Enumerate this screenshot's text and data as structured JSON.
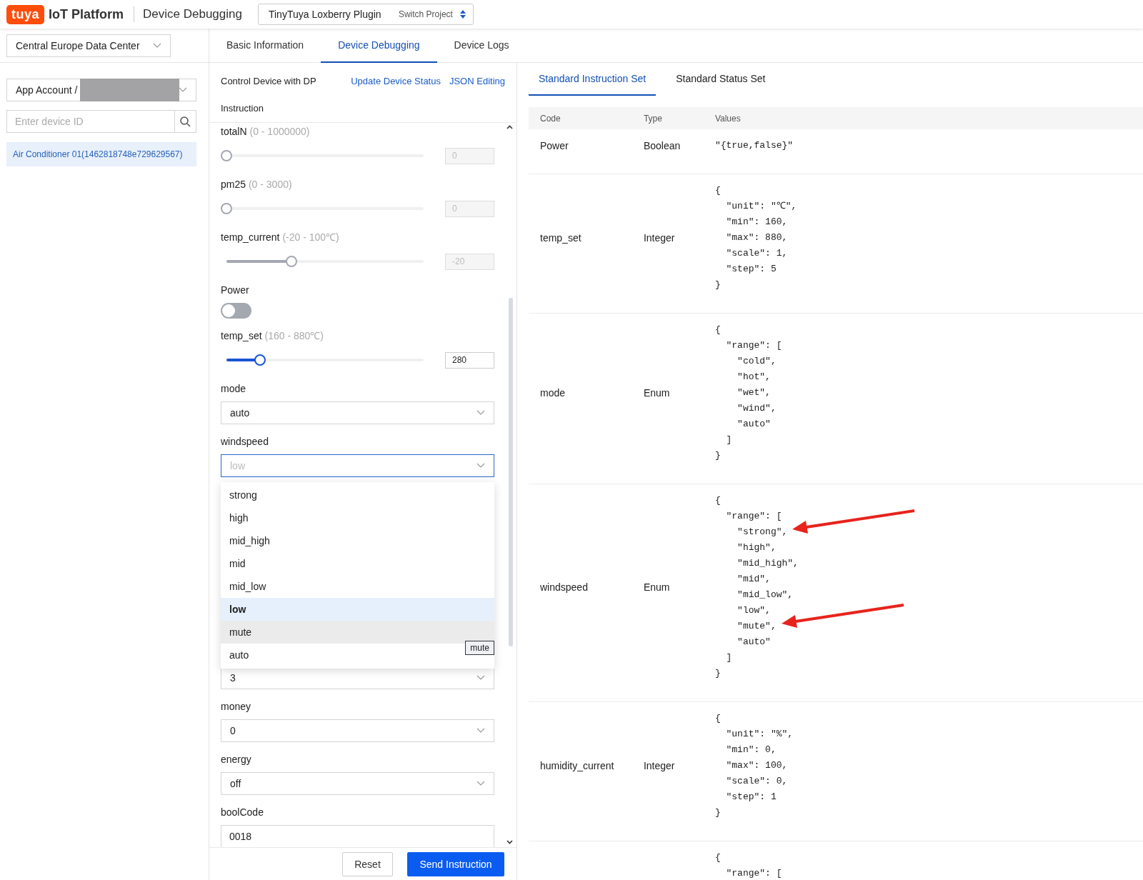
{
  "header": {
    "logo": "tuya",
    "platform": "IoT Platform",
    "page_title": "Device Debugging",
    "project": {
      "name": "TinyTuya Loxberry Plugin",
      "action": "Switch Project"
    }
  },
  "sidebar": {
    "data_center": "Central Europe Data Center",
    "account": {
      "label": "App Account /",
      "redacted": true
    },
    "search": {
      "placeholder": "Enter device ID"
    },
    "devices": [
      {
        "name": "Air Conditioner 01(1462818748e729629567)",
        "selected": true
      }
    ]
  },
  "tabs": [
    {
      "label": "Basic Information",
      "selected": false
    },
    {
      "label": "Device Debugging",
      "selected": true
    },
    {
      "label": "Device Logs",
      "selected": false
    }
  ],
  "control": {
    "title": "Control Device with DP",
    "links": [
      "Update Device Status",
      "JSON Editing"
    ],
    "section": "Instruction",
    "fields": [
      {
        "kind": "slider",
        "label": "totalN",
        "range": "(0 - 1000000)",
        "level": 0,
        "value": "0",
        "disabled": true
      },
      {
        "kind": "slider",
        "label": "pm25",
        "range": "(0 - 3000)",
        "level": 0,
        "value": "0",
        "disabled": true
      },
      {
        "kind": "slider",
        "label": "temp_current",
        "range": "(-20 - 100℃)",
        "level": 0.33,
        "value": "-20",
        "disabled": true
      },
      {
        "kind": "switch",
        "label": "Power",
        "on": false
      },
      {
        "kind": "slider",
        "label": "temp_set",
        "range": "(160 - 880℃)",
        "level": 0.17,
        "value": "280",
        "disabled": false
      },
      {
        "kind": "select",
        "label": "mode",
        "value": "auto",
        "open": false
      },
      {
        "kind": "select",
        "label": "windspeed",
        "value": "low",
        "open": true,
        "tooltip": "mute",
        "options": [
          {
            "label": "strong",
            "selected": false,
            "hovered": false
          },
          {
            "label": "high",
            "selected": false,
            "hovered": false
          },
          {
            "label": "mid_high",
            "selected": false,
            "hovered": false
          },
          {
            "label": "mid",
            "selected": false,
            "hovered": false
          },
          {
            "label": "mid_low",
            "selected": false,
            "hovered": false
          },
          {
            "label": "low",
            "selected": true,
            "hovered": false
          },
          {
            "label": "mute",
            "selected": false,
            "hovered": true
          },
          {
            "label": "auto",
            "selected": false,
            "hovered": false
          }
        ]
      },
      {
        "kind": "select",
        "value": "3",
        "open": false
      },
      {
        "kind": "select",
        "label": "money",
        "value": "0",
        "open": false
      },
      {
        "kind": "select",
        "label": "energy",
        "value": "off",
        "open": false
      },
      {
        "kind": "input",
        "label": "boolCode",
        "value": "0018"
      }
    ],
    "buttons": [
      {
        "label": "Reset",
        "kind": "secondary"
      },
      {
        "label": "Send Instruction",
        "kind": "primary"
      }
    ]
  },
  "spec": {
    "tabs": [
      {
        "label": "Standard Instruction Set",
        "selected": true
      },
      {
        "label": "Standard Status Set",
        "selected": false
      }
    ],
    "columns": [
      "Code",
      "Type",
      "Values"
    ],
    "rows": [
      {
        "code": "Power",
        "type": "Boolean",
        "values": [
          "\"{true,false}\""
        ]
      },
      {
        "code": "temp_set",
        "type": "Integer",
        "values": [
          "{",
          "  \"unit\": \"℃\",",
          "  \"min\": 160,",
          "  \"max\": 880,",
          "  \"scale\": 1,",
          "  \"step\": 5",
          "}"
        ]
      },
      {
        "code": "mode",
        "type": "Enum",
        "values": [
          "{",
          "  \"range\": [",
          "    \"cold\",",
          "    \"hot\",",
          "    \"wet\",",
          "    \"wind\",",
          "    \"auto\"",
          "  ]",
          "}"
        ]
      },
      {
        "code": "windspeed",
        "type": "Enum",
        "values": [
          "{",
          "  \"range\": [",
          {
            "text": "    \"strong\",",
            "arrow": true
          },
          "    \"high\",",
          "    \"mid_high\",",
          "    \"mid\",",
          "    \"mid_low\",",
          "    \"low\",",
          {
            "text": "    \"mute\",",
            "arrow": true
          },
          "    \"auto\"",
          "  ]",
          "}"
        ]
      },
      {
        "code": "humidity_current",
        "type": "Integer",
        "values": [
          "{",
          "  \"unit\": \"%\",",
          "  \"min\": 0,",
          "  \"max\": 100,",
          "  \"scale\": 0,",
          "  \"step\": 1",
          "}"
        ]
      },
      {
        "values": [
          "{",
          "  \"range\": ["
        ]
      }
    ]
  }
}
